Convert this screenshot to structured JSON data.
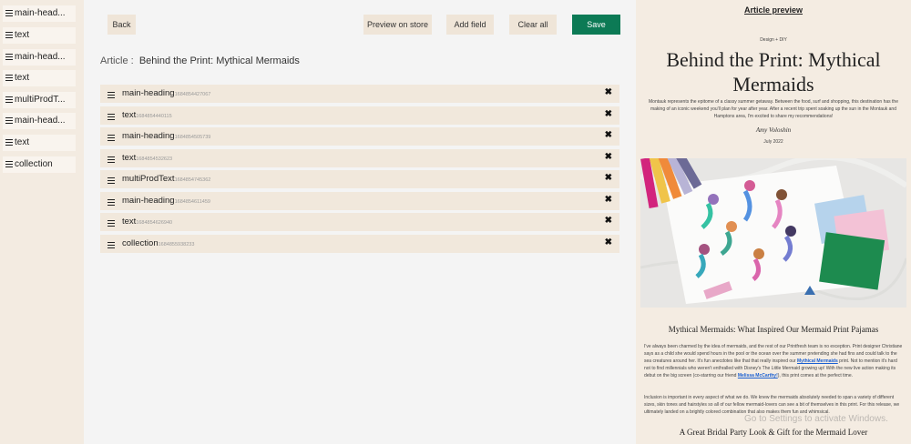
{
  "sidebar": {
    "items": [
      {
        "label": "main-head..."
      },
      {
        "label": "text"
      },
      {
        "label": "main-head..."
      },
      {
        "label": "text"
      },
      {
        "label": "multiProdT..."
      },
      {
        "label": "main-head..."
      },
      {
        "label": "text"
      },
      {
        "label": "collection"
      }
    ]
  },
  "toolbar": {
    "back": "Back",
    "preview": "Preview on store",
    "add_field": "Add field",
    "clear_all": "Clear all",
    "save": "Save",
    "save_color": "#0c7a55"
  },
  "article": {
    "label": "Article :",
    "title": "Behind the Print: Mythical Mermaids"
  },
  "fields": [
    {
      "name": "main-heading",
      "id": "1684854427067"
    },
    {
      "name": "text",
      "id": "1684854440115"
    },
    {
      "name": "main-heading",
      "id": "1684854505739"
    },
    {
      "name": "text",
      "id": "1684854532623"
    },
    {
      "name": "multiProdText",
      "id": "1684854745362"
    },
    {
      "name": "main-heading",
      "id": "1684854611459"
    },
    {
      "name": "text",
      "id": "1684854626940"
    },
    {
      "name": "collection",
      "id": "1684855938233"
    }
  ],
  "preview": {
    "heading": "Article preview",
    "category": "Design + DIY",
    "title": "Behind the Print: Mythical Mermaids",
    "intro": "Montauk represents the epitome of a classy summer getaway. Between the food, surf and shopping, this destination has the making of an iconic weekend you'll plan for year after year. After a recent trip spent soaking up the sun in the Montauk and Hamptons area, I'm excited to share my recommendations!",
    "author": "Amy Voloshin",
    "date": "July 2022",
    "subheading": "Mythical Mermaids: What Inspired Our Mermaid Print Pajamas",
    "p1_a": "I've always been charmed by the idea of mermaids, and the rest of our Printfresh team is no exception. Print designer Christiane says as a child she would spend hours in the pool or the ocean over the summer pretending she had fins and could talk to the sea creatures around her. It's fun anecdotes like that that really inspired our ",
    "p1_link1": "Mythical Mermaids",
    "p1_b": " print. Not to mention it's hard not to find millennials who weren't enthralled with Disney's The Little Mermaid growing up! With the new live action making its debut on the big screen (co-starring our friend ",
    "p1_link2": "Melissa McCarthy!",
    "p1_c": "), this print comes at the perfect time.",
    "p2": "Inclusion is important in every aspect of what we do. We knew the mermaids absolutely needed to span a variety of different sizes, skin tones and hairstyles so all of our fellow mermaid-lovers can see a bit of themselves in this print. For this release, we ultimately landed on a brightly colored combination that also makes them fun and whimsical.",
    "h2": "A Great Bridal Party Look & Gift for the Mermaid Lover"
  },
  "watermark": "Go to Settings to activate Windows."
}
